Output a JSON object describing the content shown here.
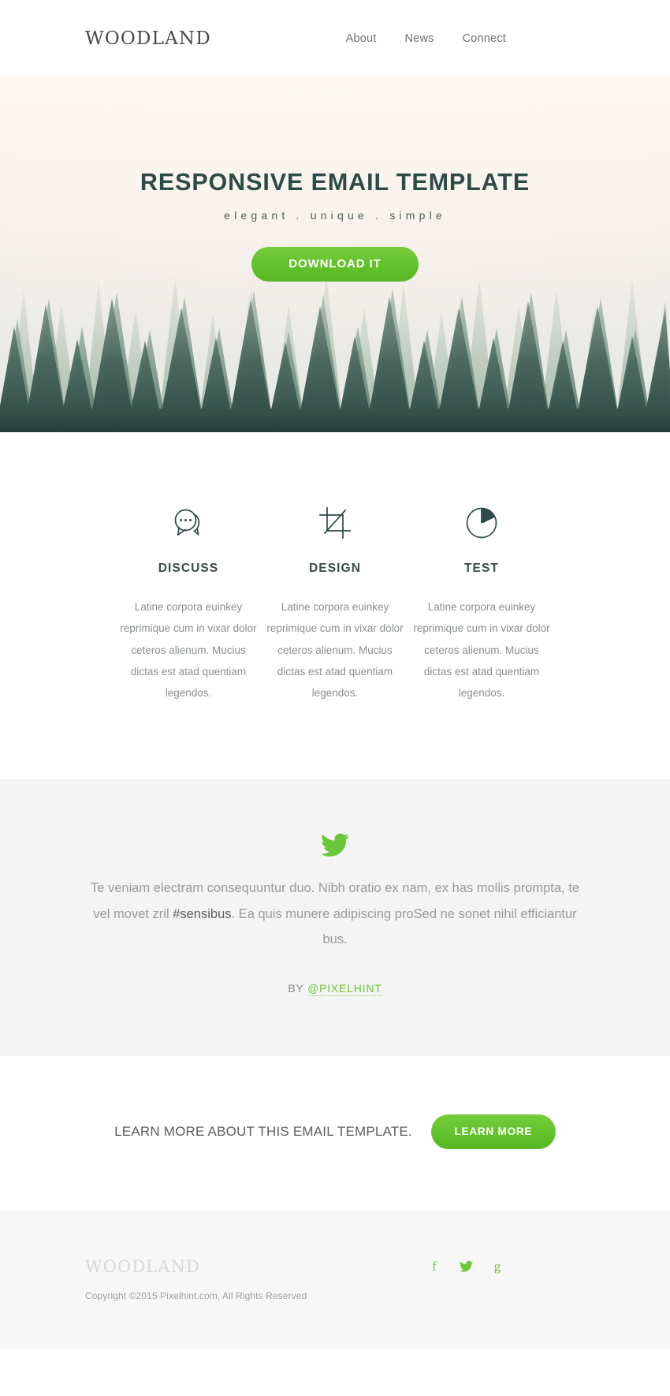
{
  "header": {
    "logo": "WOODLAND",
    "nav": [
      {
        "label": "About"
      },
      {
        "label": "News"
      },
      {
        "label": "Connect"
      }
    ]
  },
  "hero": {
    "title": "RESPONSIVE EMAIL TEMPLATE",
    "subtitle": "elegant . unique . simple",
    "button_label": "DOWNLOAD IT",
    "background_image": "misty-pine-forest-photo"
  },
  "features": [
    {
      "icon": "speech-bubbles-icon",
      "title": "DISCUSS",
      "text": "Latine corpora euinkey reprimique cum in vixar dolor ceteros alienum. Mucius dictas est atad quentiam legendos."
    },
    {
      "icon": "crop-tool-icon",
      "title": "DESIGN",
      "text": "Latine corpora euinkey reprimique cum in vixar dolor ceteros alienum. Mucius dictas est atad quentiam legendos."
    },
    {
      "icon": "pie-chart-icon",
      "title": "TEST",
      "text": "Latine corpora euinkey reprimique cum in vixar dolor ceteros alienum. Mucius dictas est atad quentiam legendos."
    }
  ],
  "tweet": {
    "icon": "twitter-bird-icon",
    "text_before": "Te veniam electram consequuntur duo. Nibh oratio ex nam, ex has mollis prompta, te vel movet zril ",
    "hashtag": "#sensibus",
    "text_after": ". Ea quis munere adipiscing proSed ne sonet nihil efficiantur bus.",
    "by_prefix": "BY ",
    "handle": "@PIXELHINT"
  },
  "cta": {
    "text": "LEARN MORE ABOUT THIS EMAIL TEMPLATE.",
    "button_label": "LEARN MORE"
  },
  "footer": {
    "logo": "WOODLAND",
    "social": [
      {
        "name": "facebook-icon",
        "glyph": "f"
      },
      {
        "name": "twitter-icon",
        "glyph": "t"
      },
      {
        "name": "google-plus-icon",
        "glyph": "g"
      }
    ],
    "copyright": "Copyright ©2015 Pixelhint.com, All Rights Reserved"
  },
  "colors": {
    "accent_green": "#66c62e",
    "hero_title": "#2e4a48",
    "body_text": "#8b8f8f",
    "tweet_bg": "#f4f4f4",
    "footer_bg": "#f7f7f7"
  }
}
